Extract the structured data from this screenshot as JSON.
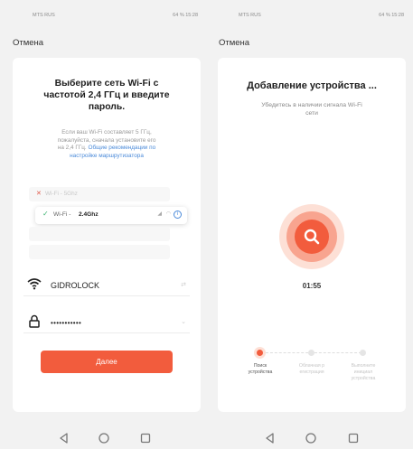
{
  "status_bar": {
    "left_text": "MTS RUS",
    "right_text": "64 % 15:28"
  },
  "left_screen": {
    "cancel_label": "Отмена",
    "title_line1": "Выберите сеть Wi-Fi с",
    "title_line2": "частотой 2,4 ГГц и введите",
    "title_line3": "пароль.",
    "note_line1": "Если ваш Wi-Fi составляет 5 ГГц,",
    "note_line2": "пожалуйста, сначала установите его",
    "note_line3_plain": "на 2,4 ГГц.",
    "note_line3_link": "Общие рекомендации по",
    "note_line4_link": "настройке маршрутизатора",
    "wifi_5g_label": "Wi-Fi - 5Ghz",
    "wifi_24_prefix": "Wi-Fi -",
    "wifi_24_band": "2.4Ghz",
    "ssid_value": "GIDROLOCK",
    "password_value": "•••••••••••",
    "next_button_label": "Далее"
  },
  "right_screen": {
    "cancel_label": "Отмена",
    "title": "Добавление устройства ...",
    "subtitle_line1": "Убедитесь в наличии сигнала Wi-Fi",
    "subtitle_line2": "сети",
    "timer": "01:55",
    "steps": [
      {
        "line1": "Поиск",
        "line2": "устройства",
        "line3": "",
        "active": true
      },
      {
        "line1": "Облачная р",
        "line2": "егистрация",
        "line3": "",
        "active": false
      },
      {
        "line1": "Выполните",
        "line2": "инициал",
        "line3": "устройства",
        "active": false
      }
    ]
  },
  "colors": {
    "accent": "#f25c3d",
    "accent_light": "#f8a48f",
    "link": "#4a8ad9",
    "check": "#3cb371"
  },
  "icons": {
    "wifi": "wifi-icon",
    "lock": "lock-icon",
    "search": "search-icon",
    "check": "checkmark-icon",
    "cross": "cross-icon",
    "nav_back": "back-triangle-icon",
    "nav_home": "home-circle-icon",
    "nav_recent": "recent-square-icon"
  }
}
